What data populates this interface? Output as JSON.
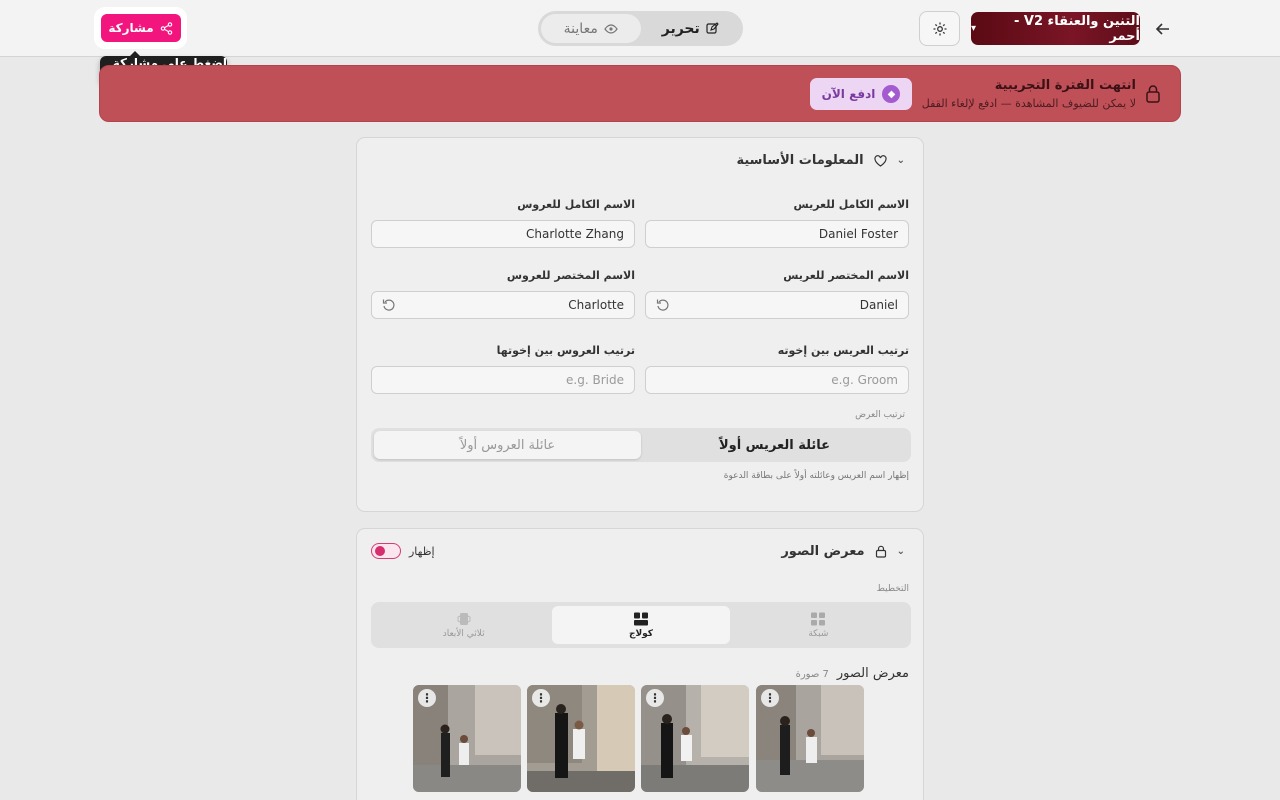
{
  "header": {
    "template_name": "التنين والعنقاء V2 - أحمر",
    "mode_edit_label": "تحرير",
    "mode_preview_label": "معاينة",
    "share_label": "مشاركة",
    "share_tooltip": "اضغط على مشاركة هنا"
  },
  "trial": {
    "title": "انتهت الفترة التجريبية",
    "subtitle": "لا يمكن للضيوف المشاهدة — ادفع لإلغاء القفل",
    "pay_label": "ادفع الآن"
  },
  "basic_info": {
    "title": "المعلومات الأساسية",
    "groom_full_label": "الاسم الكامل للعريس",
    "groom_full_value": "Daniel Foster",
    "bride_full_label": "الاسم الكامل للعروس",
    "bride_full_value": "Charlotte Zhang",
    "groom_short_label": "الاسم المختصر للعريس",
    "groom_short_value": "Daniel",
    "bride_short_label": "الاسم المختصر للعروس",
    "bride_short_value": "Charlotte",
    "groom_order_label": "ترتيب العريس بين إخوته",
    "groom_order_placeholder": "e.g. Groom",
    "bride_order_label": "ترتيب العروس بين إخوتها",
    "bride_order_placeholder": "e.g. Bride",
    "display_order_label": "ترتيب العرض",
    "groom_first_label": "عائلة العريس أولاً",
    "bride_first_label": "عائلة العروس أولاً",
    "order_hint": "إظهار اسم العريس وعائلته أولاً على بطاقة الدعوة"
  },
  "gallery": {
    "title": "معرض الصور",
    "show_label": "إظهار",
    "layout_label": "التخطيط",
    "layout_grid": "شبكة",
    "layout_collage": "كولاج",
    "layout_3d": "ثلاثي الأبعاد",
    "gallery_heading": "معرض الصور",
    "photo_count": "7 صورة",
    "menu_glyph": "⋮"
  },
  "colors": {
    "accent_pink": "#f2157e",
    "banner_red": "#bf5058",
    "template_red": "#7a1526"
  }
}
